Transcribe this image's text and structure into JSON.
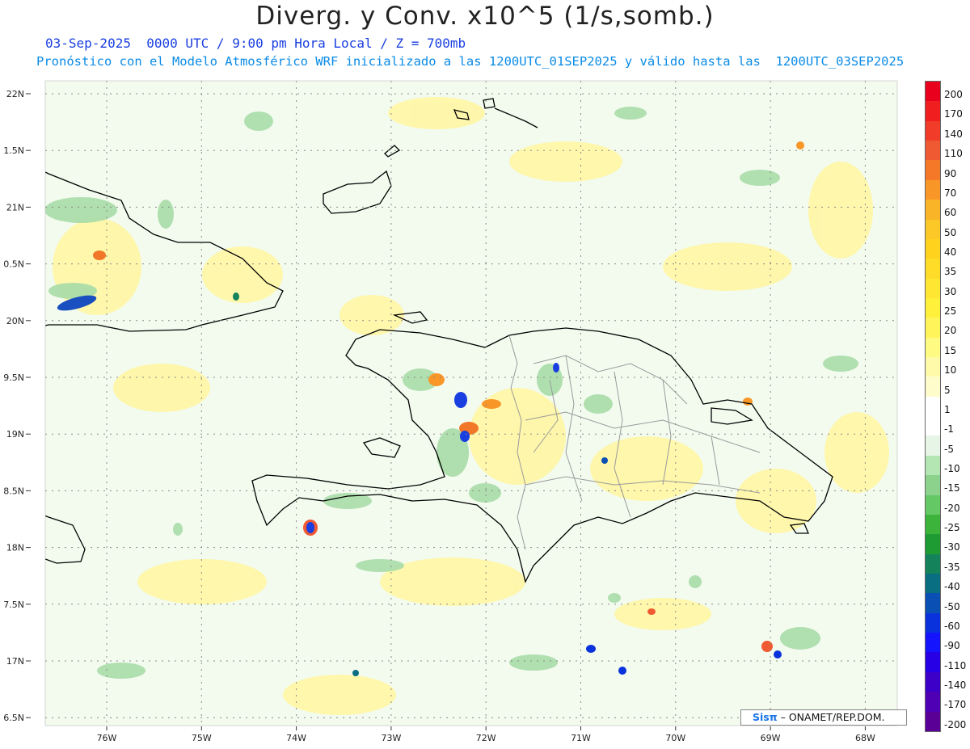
{
  "title": "Diverg. y Conv. x10^5 (1/s,somb.)",
  "subtitle_line1": "03-Sep-2025  0000 UTC / 9:00 pm Hora Local / Z = 700mb",
  "subtitle_line2": "Pronóstico con el Modelo Atmosférico WRF inicializado a las 1200UTC_01SEP2025 y válido hasta las  1200UTC_03SEP2025",
  "lat_labels": [
    "22N",
    "1.5N",
    "21N",
    "0.5N",
    "20N",
    "9.5N",
    "19N",
    "8.5N",
    "18N",
    "7.5N",
    "17N",
    "6.5N"
  ],
  "lon_labels": [
    "76W",
    "75W",
    "74W",
    "73W",
    "72W",
    "71W",
    "70W",
    "69W",
    "68W"
  ],
  "legend": {
    "labels": [
      "200",
      "170",
      "140",
      "110",
      "90",
      "70",
      "60",
      "50",
      "40",
      "35",
      "30",
      "25",
      "20",
      "15",
      "10",
      "5",
      "1",
      "-1",
      "-5",
      "-10",
      "-15",
      "-20",
      "-25",
      "-30",
      "-35",
      "-40",
      "-50",
      "-60",
      "-90",
      "-110",
      "-140",
      "-170",
      "-200"
    ],
    "colors": [
      "#e8001c",
      "#f01e1e",
      "#f03c28",
      "#f05a32",
      "#f57828",
      "#f89628",
      "#fab428",
      "#fcc828",
      "#ffd21e",
      "#ffdc28",
      "#ffe632",
      "#fff03c",
      "#fff55a",
      "#fffa82",
      "#fffaaa",
      "#fffccc",
      "#ffffff",
      "#ffffff",
      "#e6f5e6",
      "#b4e6b4",
      "#8cd28c",
      "#64c864",
      "#3cb43c",
      "#1e9b32",
      "#14825a",
      "#0a6e82",
      "#0a50b4",
      "#0a32dc",
      "#1414ff",
      "#2800e6",
      "#3c00c8",
      "#5000b4",
      "#5a0096"
    ]
  },
  "credit": {
    "logo": "Sisπ",
    "text": "– ONAMET/REP.DOM."
  },
  "map_style": {
    "ocean": "#f3fbef",
    "coast": "#000000",
    "borders": "#9a9a9a",
    "grid": "#888888"
  }
}
